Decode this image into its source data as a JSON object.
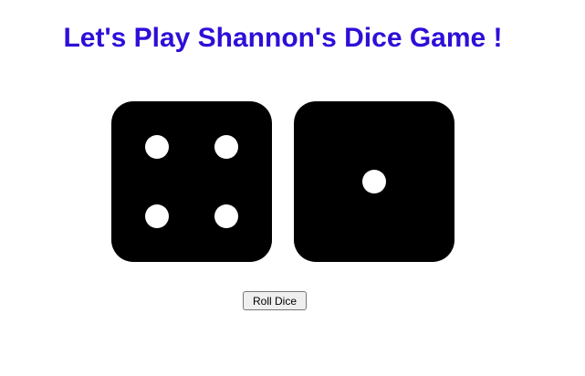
{
  "title": "Let's Play Shannon's Dice Game !",
  "colors": {
    "title": "#2d0fd8",
    "die_face": "#000000",
    "pip": "#ffffff"
  },
  "dice": [
    {
      "value": 4
    },
    {
      "value": 1
    }
  ],
  "roll_button_label": "Roll Dice"
}
